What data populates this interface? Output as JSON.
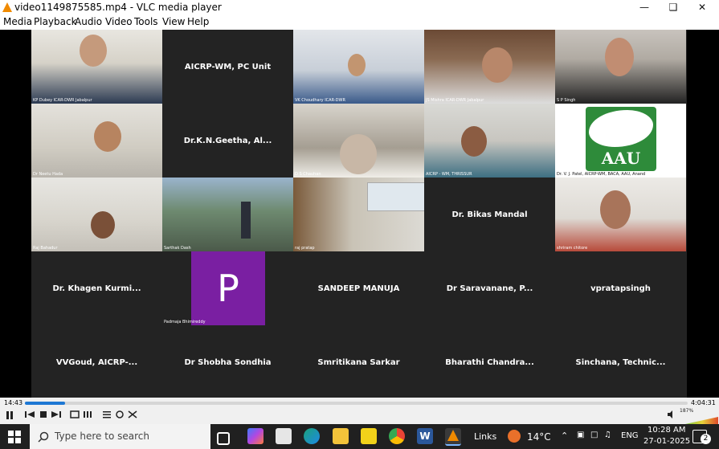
{
  "window": {
    "title": "video1149875585.mp4 - VLC media player",
    "minimize": "—",
    "restore": "❑",
    "close": "✕"
  },
  "menu": [
    "Media",
    "Playback",
    "Audio",
    "Video",
    "Tools",
    "View",
    "Help"
  ],
  "tiles": {
    "t00": "KP Dubey ICAR-DWR Jabalpur",
    "t01": "AICRP-WM, PC Unit",
    "t02": "VK Choudhary ICAR-DWR",
    "t03": "JS Mishra ICAR-DWR Jabalpur",
    "t04": "S P Singh",
    "t10": "Dr Neetu Hada",
    "t11": "Dr.K.N.Geetha,  Al...",
    "t12": "D S Chauhan",
    "t13": "AICRP - WM, THRISSUR",
    "t14": "Dr. V. J. Patel, AICRP-WM, BACA, AAU, Anand",
    "t14_logo": "AAU",
    "t20": "Raj Bahadur",
    "t21": "Sarthak Dash",
    "t22": "raj pratap",
    "t23": "Dr. Bikas Mandal",
    "t24": "shriram chitore",
    "t30": "Dr. Khagen Kurmi...",
    "t31_initial": "P",
    "t31": "Padmaja Bhimireddy",
    "t32": "SANDEEP MANUJA",
    "t33": "Dr Saravanane, P...",
    "t34": "vpratapsingh",
    "t40": "VVGoud,  AICRP-...",
    "t41": "Dr Shobha Sondhia",
    "t42": "Smritikana Sarkar",
    "t43": "Bharathi  Chandra...",
    "t44": "Sinchana,  Technic..."
  },
  "player": {
    "time_elapsed": "14:43",
    "time_total": "4:04:31",
    "progress": 0.06,
    "volume_label": "187%"
  },
  "taskbar": {
    "search_placeholder": "Type here to search",
    "links": "Links",
    "weather": "14°C",
    "lang": "ENG",
    "time": "10:28 AM",
    "date": "27-01-2025",
    "notifications": "2"
  }
}
